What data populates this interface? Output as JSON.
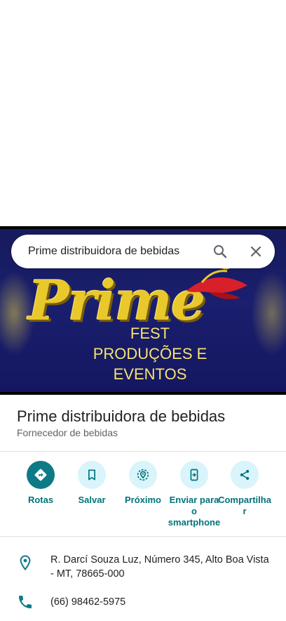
{
  "search": {
    "query": "Prime distribuidora de bebidas",
    "search_icon": "search-icon",
    "clear_icon": "close-icon"
  },
  "hero": {
    "logo_text": "Prime",
    "caption_lines": [
      "FEST",
      "PRODUÇÕES E",
      "EVENTOS"
    ]
  },
  "place": {
    "name": "Prime distribuidora de bebidas",
    "category": "Fornecedor de bebidas"
  },
  "actions": [
    {
      "label": "Rotas",
      "icon": "directions-icon"
    },
    {
      "label": "Salvar",
      "icon": "bookmark-icon"
    },
    {
      "label": "Próximo",
      "icon": "nearby-icon"
    },
    {
      "label": "Enviar para o smartphone",
      "icon": "send-to-phone-icon"
    },
    {
      "label": "Compartilhar",
      "icon": "share-icon"
    }
  ],
  "info": {
    "address": "R. Darcí Souza Luz, Número 345, Alto Boa Vista - MT, 78665-000",
    "phone": "(66) 98462-5975"
  },
  "colors": {
    "accent": "#0e7a86",
    "action_bg": "#d9f4fb",
    "action_text": "#00737c",
    "hero_bg": "#1a1f6e",
    "logo_yellow": "#e9c82c"
  }
}
